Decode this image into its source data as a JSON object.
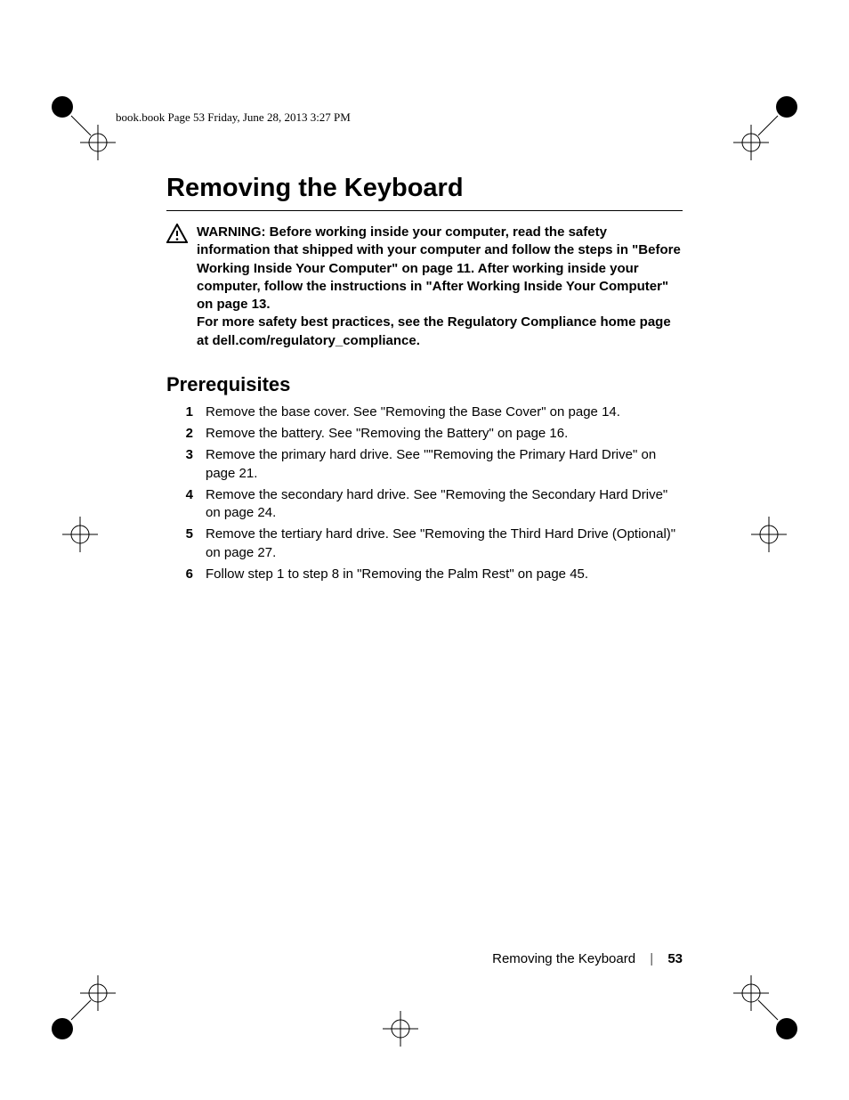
{
  "print_header": "book.book  Page 53  Friday, June 28, 2013  3:27 PM",
  "title": "Removing the Keyboard",
  "warning_label": "WARNING:",
  "warning_body_1": "Before working inside your computer, read the safety information that shipped with your computer and follow the steps in \"Before Working Inside Your Computer\" on page 11. After working inside your computer, follow the instructions in \"After Working Inside Your Computer\" on page 13.",
  "warning_body_2": "For more safety best practices, see the Regulatory Compliance home page at dell.com/regulatory_compliance.",
  "section_heading": "Prerequisites",
  "steps": [
    {
      "n": "1",
      "t": "Remove the base cover. See \"Removing the Base Cover\" on page 14."
    },
    {
      "n": "2",
      "t": "Remove the battery. See \"Removing the Battery\" on page 16."
    },
    {
      "n": "3",
      "t": "Remove the primary hard drive. See \"\"Removing the Primary Hard Drive\" on page 21."
    },
    {
      "n": "4",
      "t": "Remove the secondary hard drive. See \"Removing the Secondary Hard Drive\" on page 24."
    },
    {
      "n": "5",
      "t": "Remove the tertiary hard drive. See \"Removing the Third Hard Drive (Optional)\" on page 27."
    },
    {
      "n": "6",
      "t": "Follow step 1 to step 8 in \"Removing the Palm Rest\" on page 45."
    }
  ],
  "footer_title": "Removing the Keyboard",
  "footer_sep": "|",
  "footer_page": "53"
}
